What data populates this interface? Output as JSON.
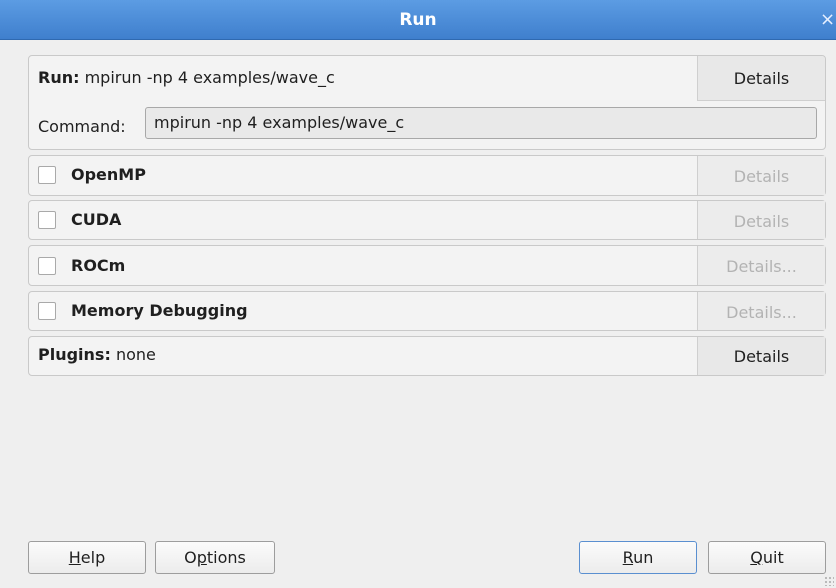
{
  "window": {
    "title": "Run",
    "close_glyph": "×"
  },
  "run_panel": {
    "label_bold": "Run:",
    "label_value": " mpirun -np 4 examples/wave_c",
    "details_label": "Details",
    "command_label": "Command:",
    "command_value": "mpirun -np 4 examples/wave_c"
  },
  "options": [
    {
      "label": "OpenMP",
      "checked": false,
      "details_label": "Details",
      "details_enabled": false
    },
    {
      "label": "CUDA",
      "checked": false,
      "details_label": "Details",
      "details_enabled": false
    },
    {
      "label": "ROCm",
      "checked": false,
      "details_label": "Details...",
      "details_enabled": false
    },
    {
      "label": "Memory Debugging",
      "checked": false,
      "details_label": "Details...",
      "details_enabled": false
    }
  ],
  "plugins_panel": {
    "label_bold": "Plugins:",
    "label_value": " none",
    "details_label": "Details"
  },
  "footer": {
    "help_mnemonic": "H",
    "help_rest": "elp",
    "options_pre": "O",
    "options_mnemonic": "p",
    "options_rest": "tions",
    "run_mnemonic": "R",
    "run_rest": "un",
    "quit_mnemonic": "Q",
    "quit_rest": "uit"
  }
}
